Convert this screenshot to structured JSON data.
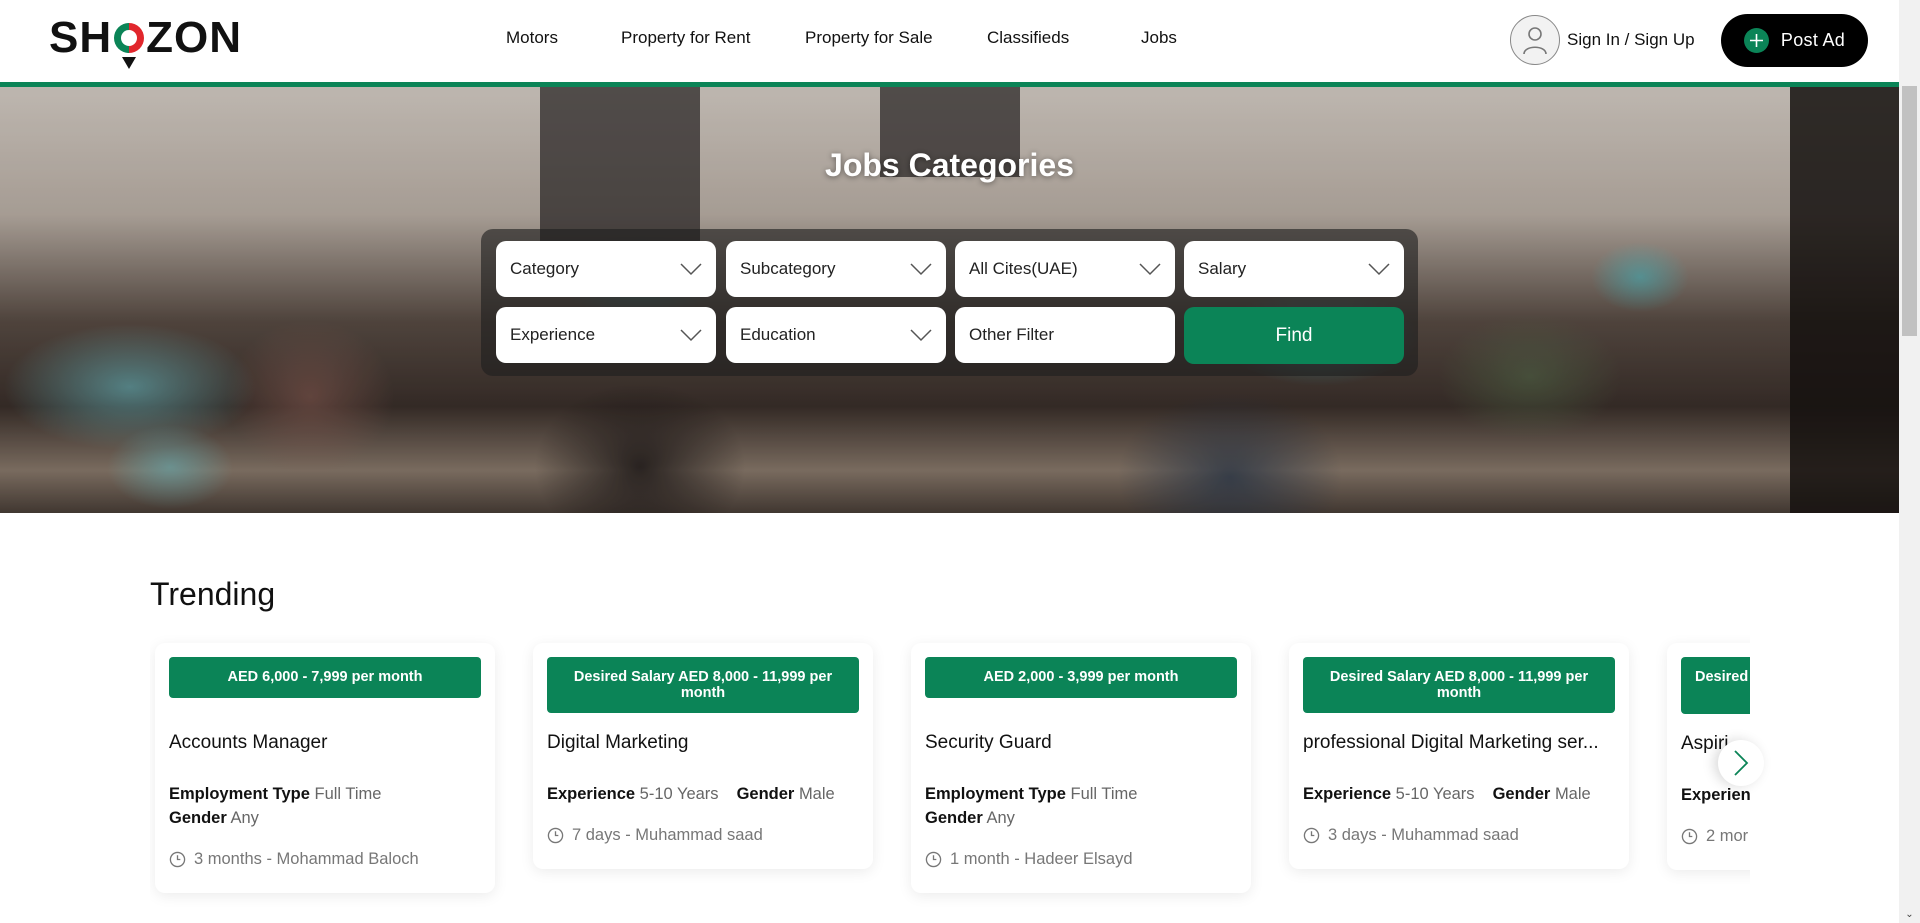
{
  "header": {
    "logo": {
      "before": "SH",
      "after": "ZON"
    },
    "nav": [
      {
        "label": "Motors"
      },
      {
        "label": "Property for Rent"
      },
      {
        "label": "Property for Sale"
      },
      {
        "label": "Classifieds"
      },
      {
        "label": "Jobs"
      }
    ],
    "signin_label": "Sign In / Sign Up",
    "post_ad_label": "Post Ad"
  },
  "colors": {
    "brand_green": "#0b8457",
    "brand_red": "#e1262c",
    "black": "#000000"
  },
  "hero": {
    "title": "Jobs Categories",
    "filters": {
      "category": "Category",
      "subcategory": "Subcategory",
      "city": "All Cites(UAE)",
      "salary": "Salary",
      "experience": "Experience",
      "education": "Education",
      "other": "Other Filter",
      "find_label": "Find"
    }
  },
  "trending": {
    "title": "Trending",
    "cards": [
      {
        "badge": "AED 6,000 - 7,999 per month",
        "title": "Accounts Manager",
        "meta": [
          {
            "key": "Employment Type",
            "value": "Full Time"
          },
          {
            "key": "Gender",
            "value": "Any"
          }
        ],
        "posted": "3 months - Mohammad Baloch"
      },
      {
        "badge": "Desired Salary AED 8,000 - 11,999 per month",
        "title": "Digital Marketing",
        "meta": [
          {
            "key": "Experience",
            "value": "5-10 Years"
          },
          {
            "key": "Gender",
            "value": "Male"
          }
        ],
        "posted": "7 days - Muhammad saad"
      },
      {
        "badge": "AED 2,000 - 3,999 per month",
        "title": "Security Guard",
        "meta": [
          {
            "key": "Employment Type",
            "value": "Full Time"
          },
          {
            "key": "Gender",
            "value": "Any"
          }
        ],
        "posted": "1 month - Hadeer Elsayd"
      },
      {
        "badge": "Desired Salary AED 8,000 - 11,999 per month",
        "title": "professional Digital Marketing ser...",
        "meta": [
          {
            "key": "Experience",
            "value": "5-10 Years"
          },
          {
            "key": "Gender",
            "value": "Male"
          }
        ],
        "posted": "3 days - Muhammad saad"
      },
      {
        "badge": "Desired",
        "title": "Aspiri",
        "meta": [
          {
            "key": "Experien",
            "value": ""
          }
        ],
        "posted": "2 mor"
      }
    ]
  }
}
